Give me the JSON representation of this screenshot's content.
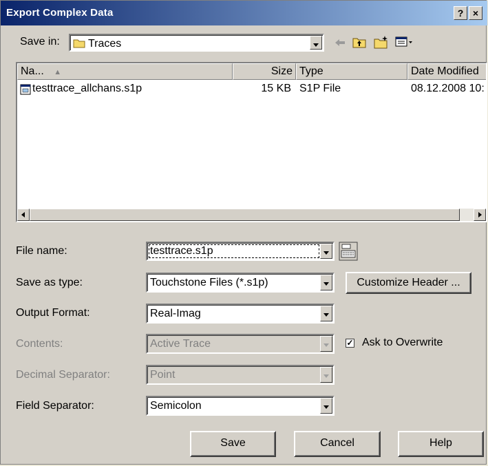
{
  "window": {
    "title": "Export Complex Data",
    "help_btn": "?",
    "close_btn": "×"
  },
  "save_in": {
    "label": "Save in:",
    "value": "Traces",
    "icon": "folder-icon"
  },
  "toolbar": {
    "back": "back-arrow-icon",
    "up": "up-folder-icon",
    "new_folder": "new-folder-icon",
    "view": "view-menu-icon"
  },
  "file_list": {
    "headers": {
      "name": "Na...",
      "size": "Size",
      "type": "Type",
      "date": "Date Modified"
    },
    "rows": [
      {
        "name": "testtrace_allchans.s1p",
        "size": "15 KB",
        "type": "S1P File",
        "date": "08.12.2008 10:"
      }
    ]
  },
  "form": {
    "file_name": {
      "label": "File name:",
      "value": "testtrace.s1p"
    },
    "save_as_type": {
      "label": "Save as type:",
      "value": "Touchstone Files (*.s1p)"
    },
    "customize_header": "Customize Header ...",
    "output_format": {
      "label": "Output Format:",
      "value": "Real-Imag"
    },
    "contents": {
      "label": "Contents:",
      "value": "Active Trace"
    },
    "ask_overwrite": {
      "label": "Ask to Overwrite",
      "checked": true
    },
    "decimal_separator": {
      "label": "Decimal Separator:",
      "value": "Point"
    },
    "field_separator": {
      "label": "Field Separator:",
      "value": "Semicolon"
    }
  },
  "buttons": {
    "save": "Save",
    "cancel": "Cancel",
    "help": "Help"
  }
}
